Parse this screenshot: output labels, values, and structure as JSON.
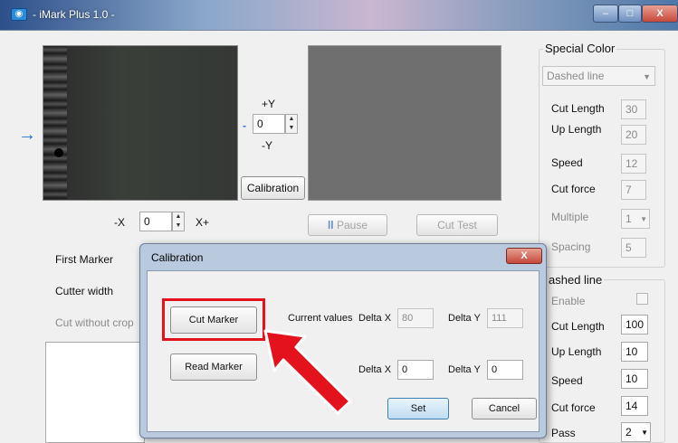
{
  "window": {
    "title": "- iMark Plus 1.0 -",
    "min": "–",
    "max": "□",
    "close": "X"
  },
  "axis": {
    "plus_y": "+Y",
    "minus_y": "-Y",
    "y_value": "0",
    "minus_x": "-X",
    "x_value": "0",
    "plus_x": "X+",
    "arrow": "→"
  },
  "buttons": {
    "calibration": "Calibration",
    "pause": "Pause",
    "cut_test": "Cut Test"
  },
  "left_labels": {
    "first_marker": "First Marker",
    "cutter_width": "Cutter width",
    "cut_without_crop": "Cut without crop"
  },
  "special": {
    "title": "Special Color",
    "dropdown": "Dashed line",
    "cut_length": "Cut Length",
    "cut_length_val": "30",
    "up_length": "Up Length",
    "up_length_val": "20",
    "speed": "Speed",
    "speed_val": "12",
    "cut_force": "Cut force",
    "cut_force_val": "7",
    "multiple": "Multiple",
    "multiple_val": "1",
    "spacing": "Spacing",
    "spacing_val": "5"
  },
  "dashed": {
    "title": "ashed line",
    "enable": "Enable",
    "cut_length": "Cut Length",
    "cut_length_val": "100",
    "up_length": "Up Length",
    "up_length_val": "10",
    "speed": "Speed",
    "speed_val": "10",
    "cut_force": "Cut force",
    "cut_force_val": "14",
    "pass": "Pass",
    "pass_val": "2"
  },
  "dialog": {
    "title": "Calibration",
    "close": "X",
    "cut_marker": "Cut Marker",
    "read_marker": "Read Marker",
    "current_values": "Current values",
    "delta_x": "Delta X",
    "delta_y": "Delta Y",
    "cur_dx": "80",
    "cur_dy": "111",
    "new_dx": "0",
    "new_dy": "0",
    "set": "Set",
    "cancel": "Cancel"
  },
  "colors": {
    "highlight": "#e4121d",
    "arrow": "#e4121d",
    "accent": "#2a6fd6"
  }
}
